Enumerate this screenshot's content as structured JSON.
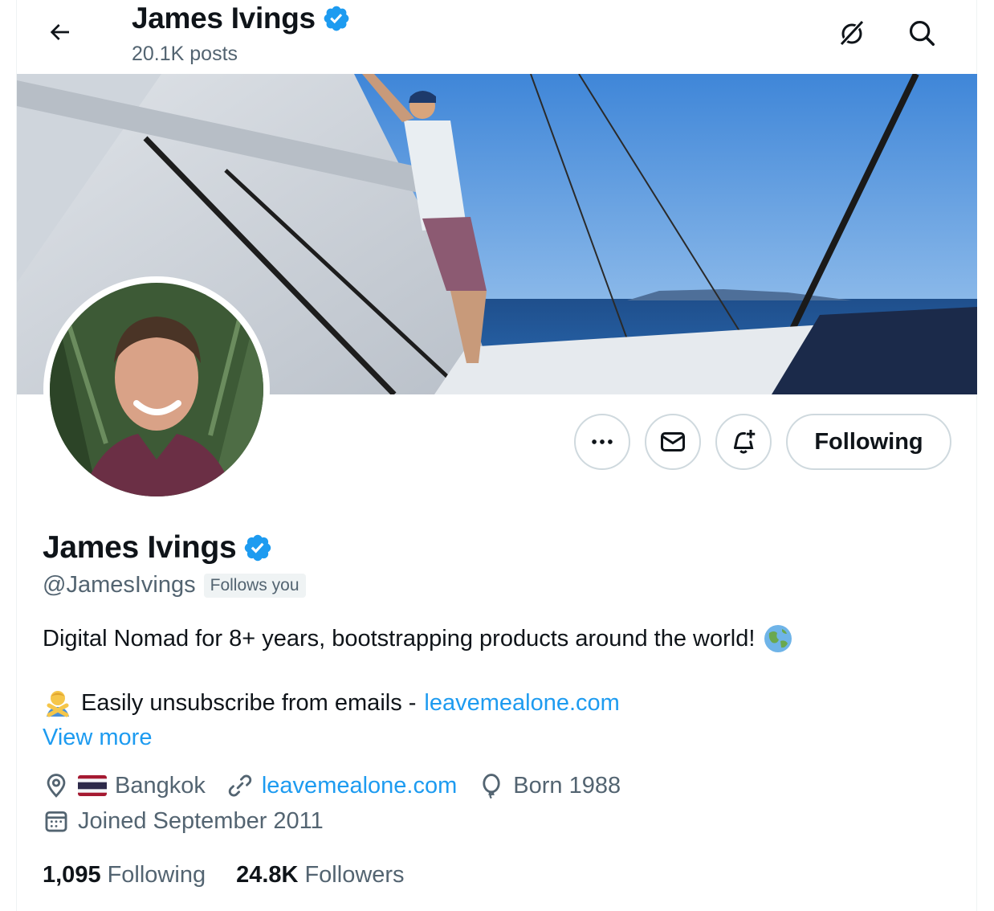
{
  "header": {
    "title": "James Ivings",
    "posts": "20.1K posts"
  },
  "profile": {
    "name": "James Ivings",
    "handle": "@JamesIvings",
    "follows_you": "Follows you",
    "bio_line1": "Digital Nomad for 8+ years, bootstrapping products around the world!",
    "bio_line2_prefix": "Easily unsubscribe from emails -",
    "bio_link": "leavemealone.com",
    "view_more": "View more",
    "location": "Bangkok",
    "website": "leavemealone.com",
    "born": "Born 1988",
    "joined": "Joined September 2011"
  },
  "actions": {
    "following_label": "Following"
  },
  "stats": {
    "following_count": "1,095",
    "following_label": "Following",
    "followers_count": "24.8K",
    "followers_label": "Followers"
  },
  "icons": {
    "back": "arrow-left-icon",
    "grok": "grok-icon",
    "search": "search-icon",
    "more": "more-dots-icon",
    "message": "envelope-icon",
    "notify": "bell-plus-icon",
    "verified": "verified-badge-icon",
    "location": "location-pin-icon",
    "link": "link-icon",
    "birthday": "balloon-icon",
    "calendar": "calendar-icon"
  },
  "colors": {
    "accent": "#1d9bf0",
    "text": "#0f1419",
    "secondary": "#536471",
    "border": "#cfd9de"
  }
}
